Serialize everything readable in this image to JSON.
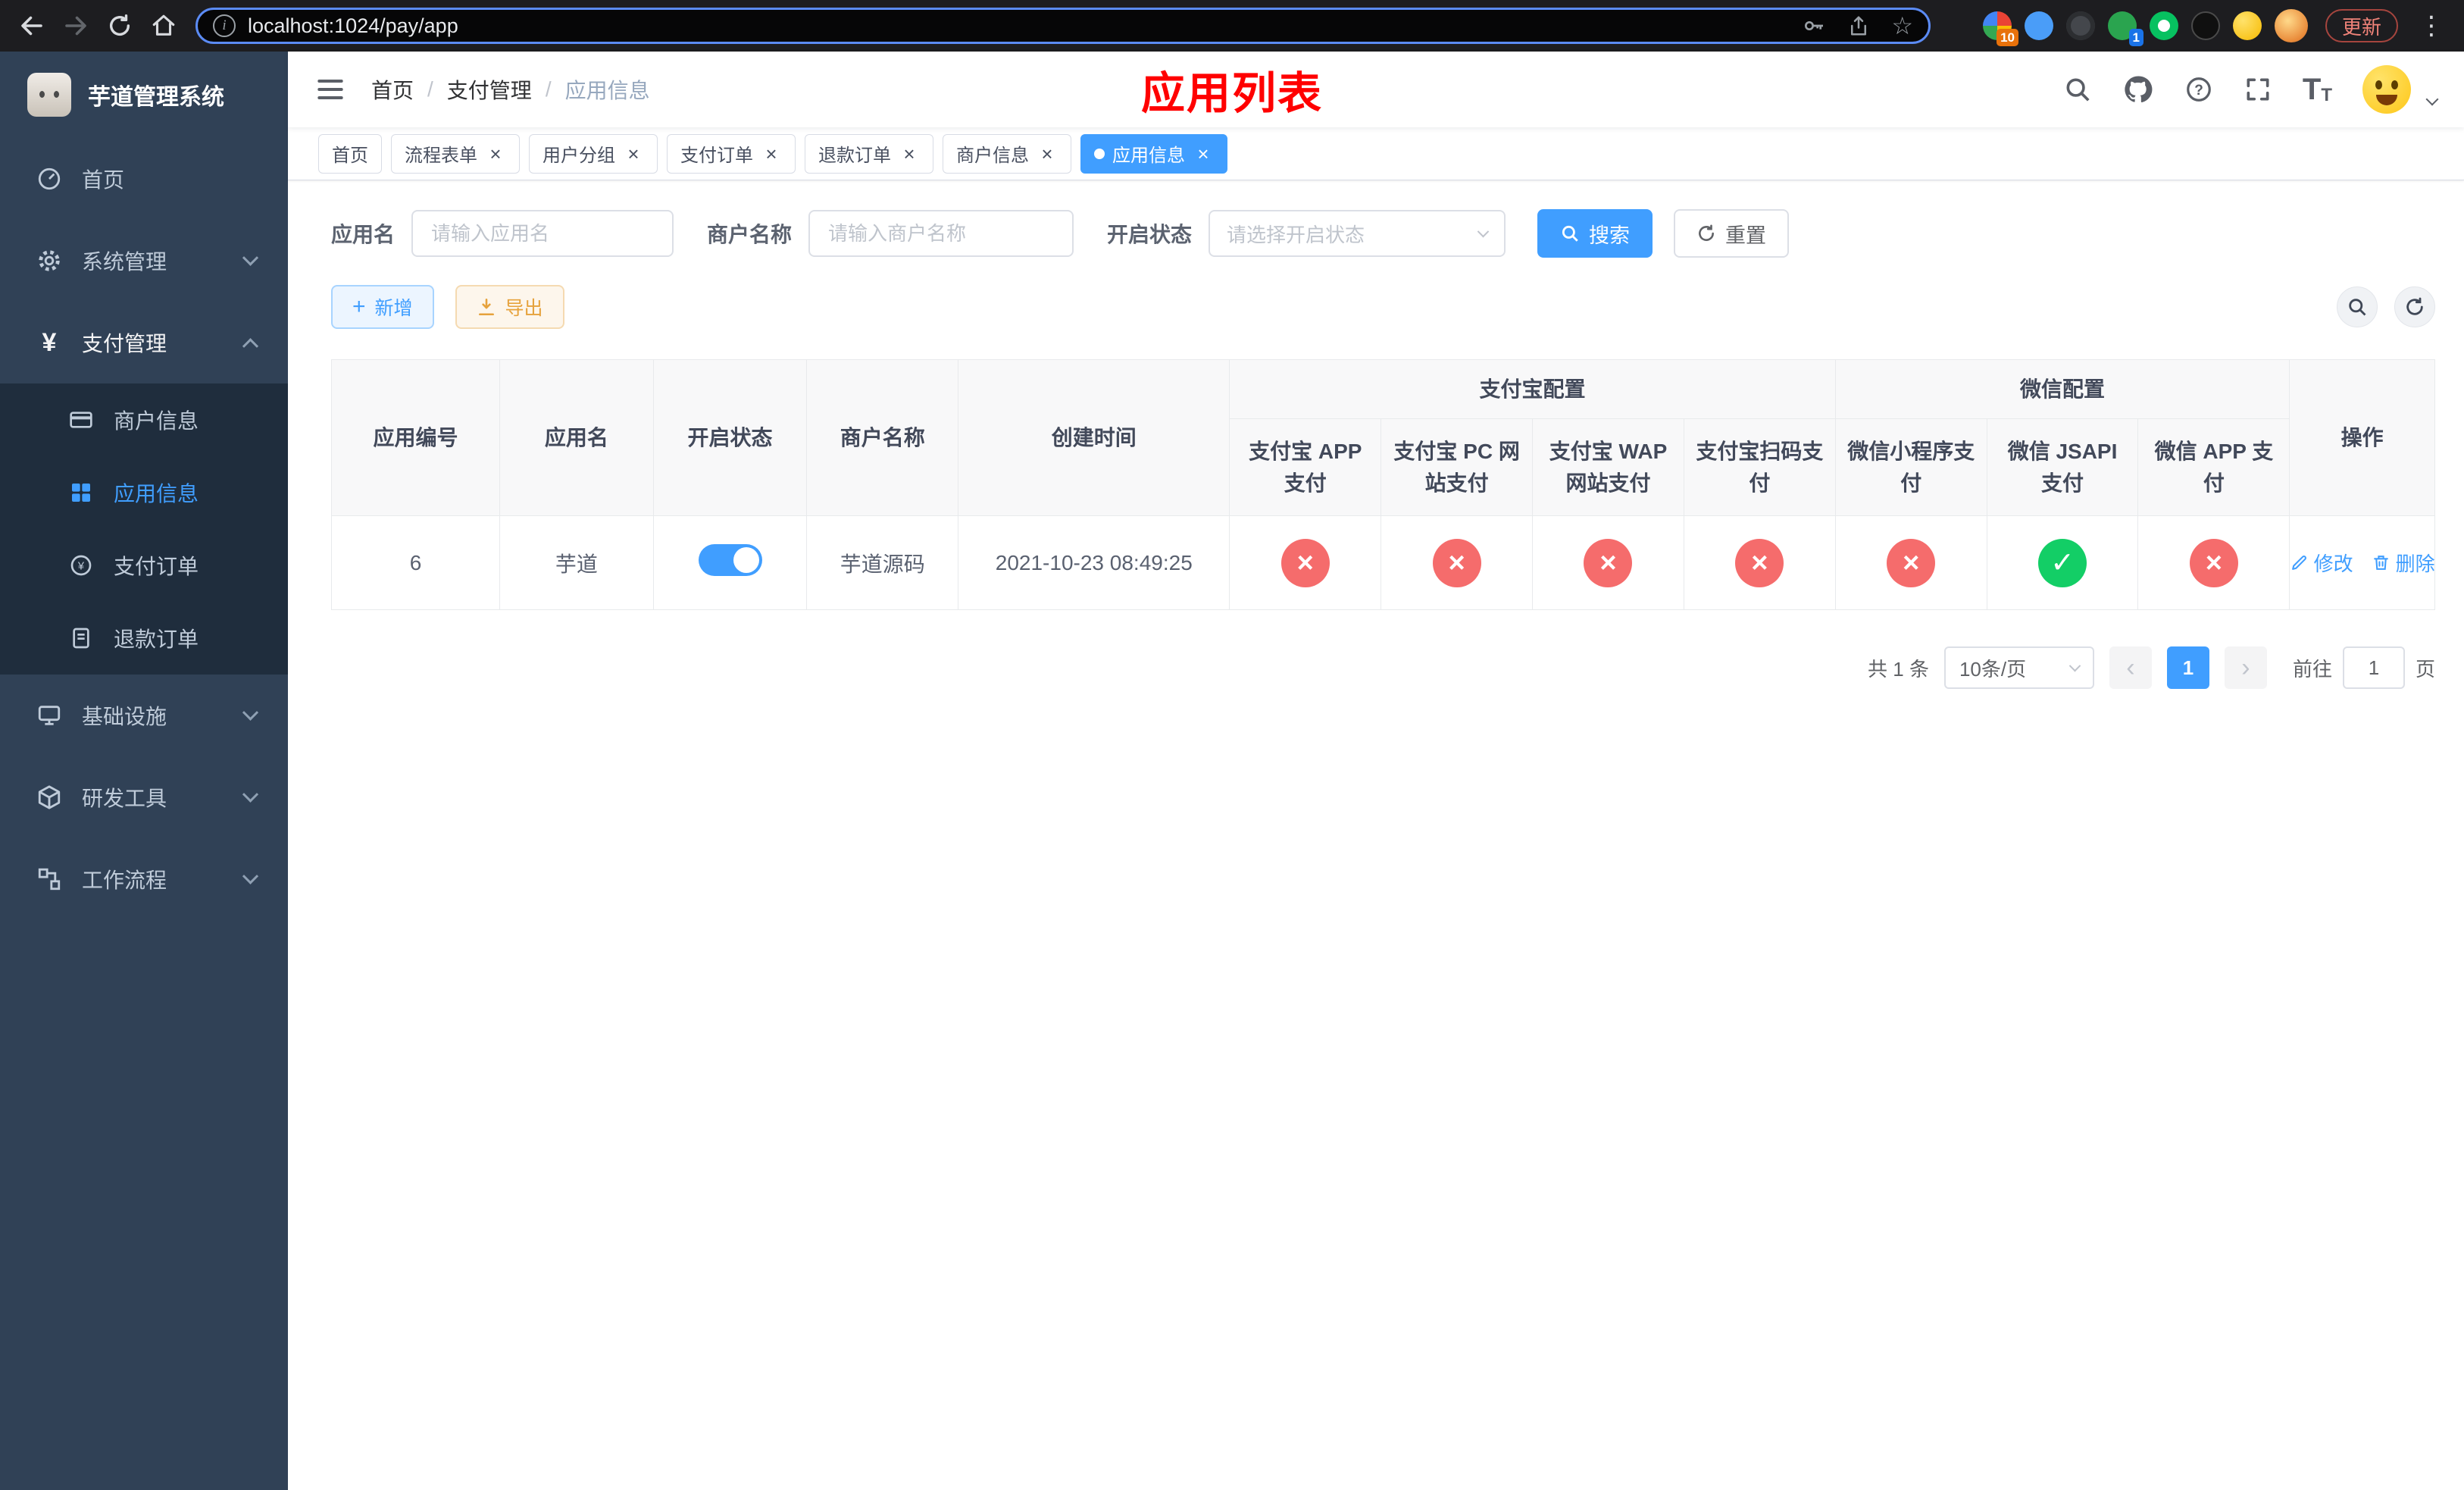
{
  "browser": {
    "url": "localhost:1024/pay/app",
    "update_label": "更新",
    "extensions_badge": "10",
    "extension_badge_2": "1"
  },
  "sidebar": {
    "app_title": "芋道管理系统",
    "home": "首页",
    "system": "系统管理",
    "payment": "支付管理",
    "merchant_info": "商户信息",
    "app_info": "应用信息",
    "pay_order": "支付订单",
    "refund_order": "退款订单",
    "infrastructure": "基础设施",
    "dev_tools": "研发工具",
    "workflow": "工作流程"
  },
  "navbar": {
    "breadcrumb_home": "首页",
    "breadcrumb_section": "支付管理",
    "breadcrumb_page": "应用信息",
    "overlay_title": "应用列表"
  },
  "tabs": {
    "home": "首页",
    "process_form": "流程表单",
    "user_group": "用户分组",
    "pay_order": "支付订单",
    "refund_order": "退款订单",
    "merchant_info": "商户信息",
    "app_info": "应用信息"
  },
  "filters": {
    "app_name_label": "应用名",
    "app_name_placeholder": "请输入应用名",
    "merchant_label": "商户名称",
    "merchant_placeholder": "请输入商户名称",
    "status_label": "开启状态",
    "status_placeholder": "请选择开启状态",
    "search_label": "搜索",
    "reset_label": "重置"
  },
  "toolbar": {
    "add_label": "新增",
    "export_label": "导出"
  },
  "table": {
    "headers": {
      "app_id": "应用编号",
      "app_name": "应用名",
      "status": "开启状态",
      "merchant_name": "商户名称",
      "created_at": "创建时间",
      "alipay_group": "支付宝配置",
      "wechat_group": "微信配置",
      "alipay_app": "支付宝 APP 支付",
      "alipay_pc": "支付宝 PC 网站支付",
      "alipay_wap": "支付宝 WAP 网站支付",
      "alipay_qr": "支付宝扫码支付",
      "wx_mini": "微信小程序支付",
      "wx_jsapi": "微信 JSAPI 支付",
      "wx_app": "微信 APP 支付",
      "actions": "操作"
    },
    "rows": [
      {
        "app_id": "6",
        "app_name": "芋道",
        "status": true,
        "merchant_name": "芋道源码",
        "created_at": "2021-10-23 08:49:25",
        "configs": [
          false,
          false,
          false,
          false,
          false,
          true,
          false
        ],
        "edit_label": "修改",
        "delete_label": "删除"
      }
    ]
  },
  "pagination": {
    "total_label": "共 1 条",
    "page_size_label": "10条/页",
    "current_page": "1",
    "goto_label": "前往",
    "goto_value": "1",
    "unit_label": "页"
  },
  "icons": {
    "close": "×",
    "star": "☆",
    "check": "✓",
    "cross": "×",
    "yen": "¥",
    "prev": "‹",
    "next": "›",
    "plus": "+",
    "dots_vertical": "⋮"
  },
  "colors": {
    "primary": "#409eff",
    "success": "#13ce66",
    "danger": "#f56c6c",
    "warning": "#e6a23c",
    "sidebar_bg": "#304156",
    "submenu_bg": "#1f2d3d",
    "annotation": "#ff0000"
  }
}
